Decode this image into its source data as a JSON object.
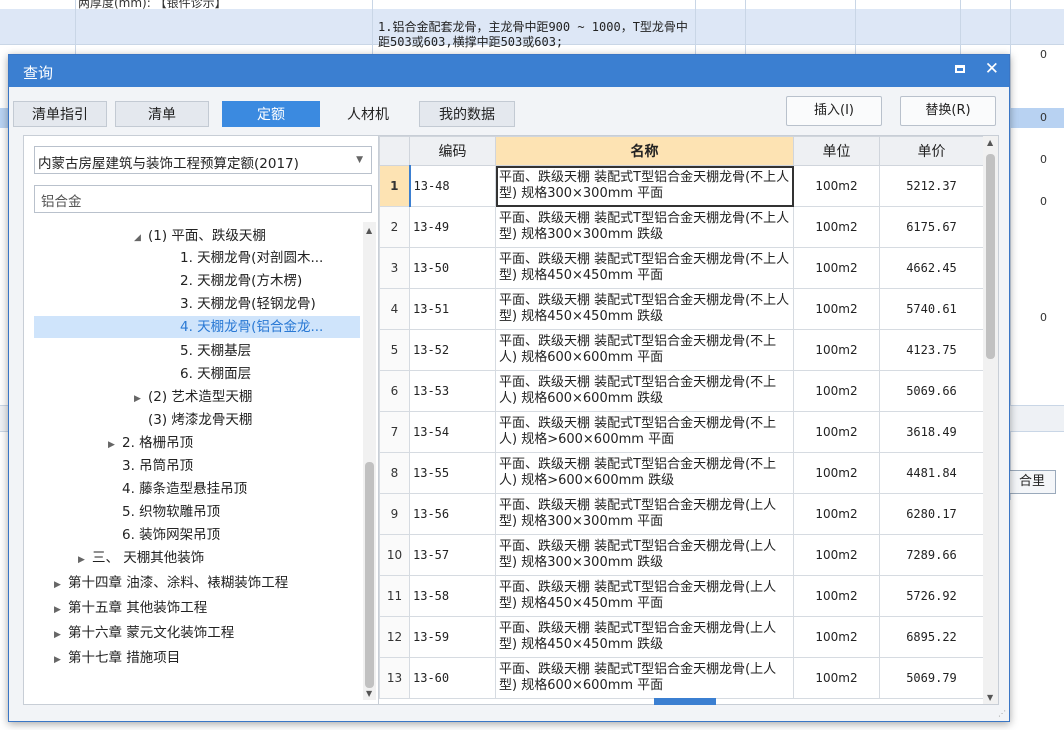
{
  "background": {
    "top_text": "两厚度(mm): 【银件诊示】",
    "row_text": "1.铝合金配套龙骨，主龙骨中距900 ~ 1000，T型龙骨中距503或603,横撑中距503或603;",
    "right_values": [
      "0",
      "0",
      "0",
      "0",
      "0"
    ],
    "side_button": "合里"
  },
  "dialog": {
    "title": "查询",
    "tabs": [
      "清单指引",
      "清单",
      "定额",
      "人材机",
      "我的数据"
    ],
    "active_tab": "定额",
    "insert_button": "插入(I)",
    "replace_button": "替换(R)"
  },
  "left": {
    "library_select": "内蒙古房屋建筑与装饰工程预算定额(2017)",
    "search_value": "铝合金",
    "tree": [
      {
        "label": "(1) 平面、跌级天棚",
        "caret": "◢"
      },
      {
        "label": "1. 天棚龙骨(对剖圆木...",
        "caret": ""
      },
      {
        "label": "2. 天棚龙骨(方木楞)",
        "caret": ""
      },
      {
        "label": "3. 天棚龙骨(轻钢龙骨)",
        "caret": ""
      },
      {
        "label": "4. 天棚龙骨(铝合金龙...",
        "caret": ""
      },
      {
        "label": "5. 天棚基层",
        "caret": ""
      },
      {
        "label": "6. 天棚面层",
        "caret": ""
      },
      {
        "label": "(2) 艺术造型天棚",
        "caret": "▶"
      },
      {
        "label": "(3) 烤漆龙骨天棚",
        "caret": ""
      },
      {
        "label": "2. 格栅吊顶",
        "caret": "▶"
      },
      {
        "label": "3. 吊筒吊顶",
        "caret": ""
      },
      {
        "label": "4. 藤条造型悬挂吊顶",
        "caret": ""
      },
      {
        "label": "5. 织物软雕吊顶",
        "caret": ""
      },
      {
        "label": "6. 装饰网架吊顶",
        "caret": ""
      },
      {
        "label": "三、 天棚其他装饰",
        "caret": "▶"
      },
      {
        "label": "第十四章 油漆、涂料、裱糊装饰工程",
        "caret": "▶"
      },
      {
        "label": "第十五章 其他装饰工程",
        "caret": "▶"
      },
      {
        "label": "第十六章 蒙元文化装饰工程",
        "caret": "▶"
      },
      {
        "label": "第十七章 措施项目",
        "caret": "▶"
      }
    ]
  },
  "table": {
    "headers": [
      "编码",
      "名称",
      "单位",
      "单价"
    ],
    "rows": [
      {
        "idx": "1",
        "code": "13-48",
        "name": "平面、跌级天棚 装配式T型铝合金天棚龙骨(不上人型) 规格300×300mm 平面",
        "unit": "100m2",
        "price": "5212.37"
      },
      {
        "idx": "2",
        "code": "13-49",
        "name": "平面、跌级天棚 装配式T型铝合金天棚龙骨(不上人型) 规格300×300mm 跌级",
        "unit": "100m2",
        "price": "6175.67"
      },
      {
        "idx": "3",
        "code": "13-50",
        "name": "平面、跌级天棚 装配式T型铝合金天棚龙骨(不上人型) 规格450×450mm 平面",
        "unit": "100m2",
        "price": "4662.45"
      },
      {
        "idx": "4",
        "code": "13-51",
        "name": "平面、跌级天棚 装配式T型铝合金天棚龙骨(不上人型) 规格450×450mm 跌级",
        "unit": "100m2",
        "price": "5740.61"
      },
      {
        "idx": "5",
        "code": "13-52",
        "name": "平面、跌级天棚 装配式T型铝合金天棚龙骨(不上人) 规格600×600mm 平面",
        "unit": "100m2",
        "price": "4123.75"
      },
      {
        "idx": "6",
        "code": "13-53",
        "name": "平面、跌级天棚 装配式T型铝合金天棚龙骨(不上人) 规格600×600mm 跌级",
        "unit": "100m2",
        "price": "5069.66"
      },
      {
        "idx": "7",
        "code": "13-54",
        "name": "平面、跌级天棚 装配式T型铝合金天棚龙骨(不上人) 规格>600×600mm 平面",
        "unit": "100m2",
        "price": "3618.49"
      },
      {
        "idx": "8",
        "code": "13-55",
        "name": "平面、跌级天棚 装配式T型铝合金天棚龙骨(不上人) 规格>600×600mm 跌级",
        "unit": "100m2",
        "price": "4481.84"
      },
      {
        "idx": "9",
        "code": "13-56",
        "name": "平面、跌级天棚 装配式T型铝合金天棚龙骨(上人型) 规格300×300mm 平面",
        "unit": "100m2",
        "price": "6280.17"
      },
      {
        "idx": "10",
        "code": "13-57",
        "name": "平面、跌级天棚 装配式T型铝合金天棚龙骨(上人型) 规格300×300mm 跌级",
        "unit": "100m2",
        "price": "7289.66"
      },
      {
        "idx": "11",
        "code": "13-58",
        "name": "平面、跌级天棚 装配式T型铝合金天棚龙骨(上人型) 规格450×450mm 平面",
        "unit": "100m2",
        "price": "5726.92"
      },
      {
        "idx": "12",
        "code": "13-59",
        "name": "平面、跌级天棚 装配式T型铝合金天棚龙骨(上人型) 规格450×450mm 跌级",
        "unit": "100m2",
        "price": "6895.22"
      },
      {
        "idx": "13",
        "code": "13-60",
        "name": "平面、跌级天棚 装配式T型铝合金天棚龙骨(上人型) 规格600×600mm 平面",
        "unit": "100m2",
        "price": "5069.79"
      }
    ]
  },
  "colors": {
    "titlebar": "#3b7fd1",
    "active_tab": "#3b8ae0",
    "name_header": "#fde3b3",
    "selected_tree_item": "#cfe4fb"
  }
}
